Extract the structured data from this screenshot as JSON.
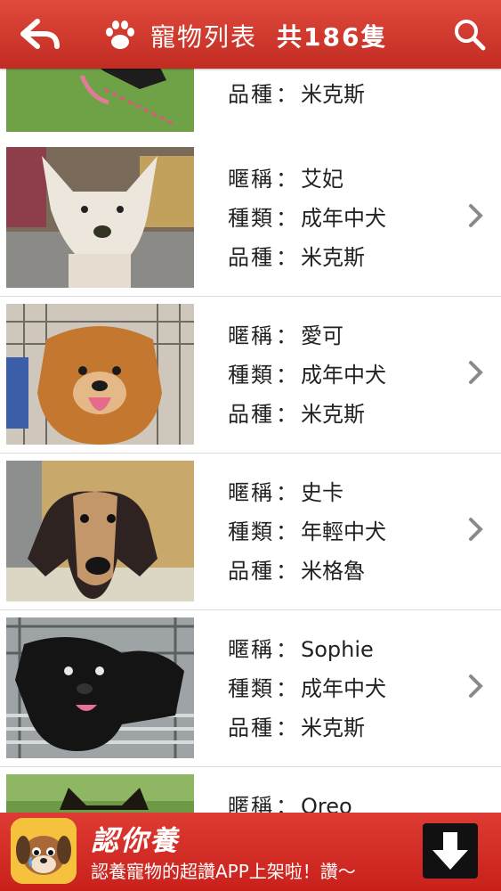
{
  "header": {
    "title": "寵物列表",
    "count_label": "共186隻",
    "color": "#c9302a"
  },
  "labels": {
    "nickname": "暱稱",
    "type": "種類",
    "breed": "品種",
    "separator": "："
  },
  "pets": [
    {
      "nickname": "",
      "type": "成年中犬",
      "breed": "米克斯"
    },
    {
      "nickname": "艾妃",
      "type": "成年中犬",
      "breed": "米克斯"
    },
    {
      "nickname": "愛可",
      "type": "成年中犬",
      "breed": "米克斯"
    },
    {
      "nickname": "史卡",
      "type": "年輕中犬",
      "breed": "米格魯"
    },
    {
      "nickname": "Sophie",
      "type": "成年中犬",
      "breed": "米克斯"
    },
    {
      "nickname": "Oreo",
      "type": "",
      "breed": ""
    }
  ],
  "ad": {
    "app_name": "認你養",
    "description": "認養寵物的超讚APP上架啦！讚～"
  },
  "icons": {
    "back": "back-arrow-icon",
    "paw": "paw-icon",
    "search": "search-icon",
    "chevron": "chevron-right-icon",
    "download": "download-icon"
  }
}
